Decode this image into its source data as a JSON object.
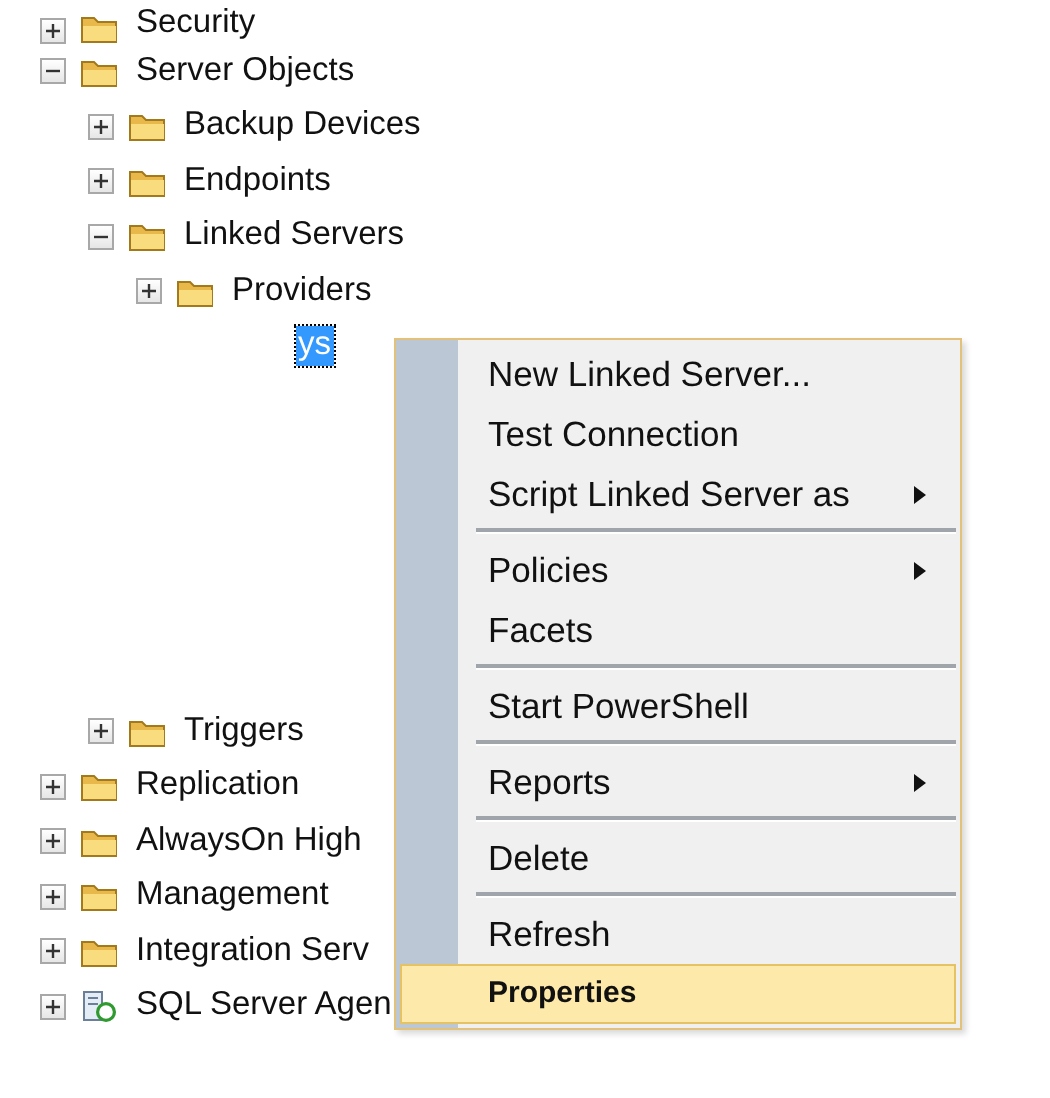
{
  "tree": [
    {
      "label": "Security",
      "kind": "folder",
      "expanded": false,
      "selected": false
    },
    {
      "label": "Server Objects",
      "kind": "folder",
      "expanded": true,
      "selected": false,
      "children": [
        {
          "label": "Backup Devices",
          "kind": "folder",
          "expanded": false,
          "selected": false
        },
        {
          "label": "Endpoints",
          "kind": "folder",
          "expanded": false,
          "selected": false
        },
        {
          "label": "Linked Servers",
          "kind": "folder",
          "expanded": true,
          "selected": false,
          "children": [
            {
              "label": "Providers",
              "kind": "folder",
              "expanded": false,
              "selected": false
            },
            {
              "label": "ys",
              "kind": "covered",
              "selected": true
            }
          ]
        },
        {
          "label": "Triggers",
          "kind": "folder",
          "expanded": false,
          "selected": false
        }
      ]
    },
    {
      "label": "Replication",
      "kind": "folder",
      "expanded": false,
      "selected": false
    },
    {
      "label": "AlwaysOn High",
      "kind": "folder",
      "expanded": false,
      "selected": false
    },
    {
      "label": "Management",
      "kind": "folder",
      "expanded": false,
      "selected": false
    },
    {
      "label": "Integration Serv",
      "kind": "folder",
      "expanded": false,
      "selected": false
    },
    {
      "label": "SQL Server Agen",
      "kind": "agent",
      "expanded": false,
      "selected": false
    }
  ],
  "context_menu": [
    {
      "kind": "item",
      "label": "New Linked Server...",
      "submenu": false,
      "selected": false,
      "default": false
    },
    {
      "kind": "item",
      "label": "Test Connection",
      "submenu": false,
      "selected": false,
      "default": false
    },
    {
      "kind": "item",
      "label": "Script Linked Server as",
      "submenu": true,
      "selected": false,
      "default": false
    },
    {
      "kind": "separator"
    },
    {
      "kind": "item",
      "label": "Policies",
      "submenu": true,
      "selected": false,
      "default": false
    },
    {
      "kind": "item",
      "label": "Facets",
      "submenu": false,
      "selected": false,
      "default": false
    },
    {
      "kind": "separator"
    },
    {
      "kind": "item",
      "label": "Start PowerShell",
      "submenu": false,
      "selected": false,
      "default": false
    },
    {
      "kind": "separator"
    },
    {
      "kind": "item",
      "label": "Reports",
      "submenu": true,
      "selected": false,
      "default": false
    },
    {
      "kind": "separator"
    },
    {
      "kind": "item",
      "label": "Delete",
      "submenu": false,
      "selected": false,
      "default": false
    },
    {
      "kind": "separator"
    },
    {
      "kind": "item",
      "label": "Refresh",
      "submenu": false,
      "selected": false,
      "default": false
    },
    {
      "kind": "item",
      "label": "Properties",
      "submenu": false,
      "selected": true,
      "default": true
    }
  ]
}
